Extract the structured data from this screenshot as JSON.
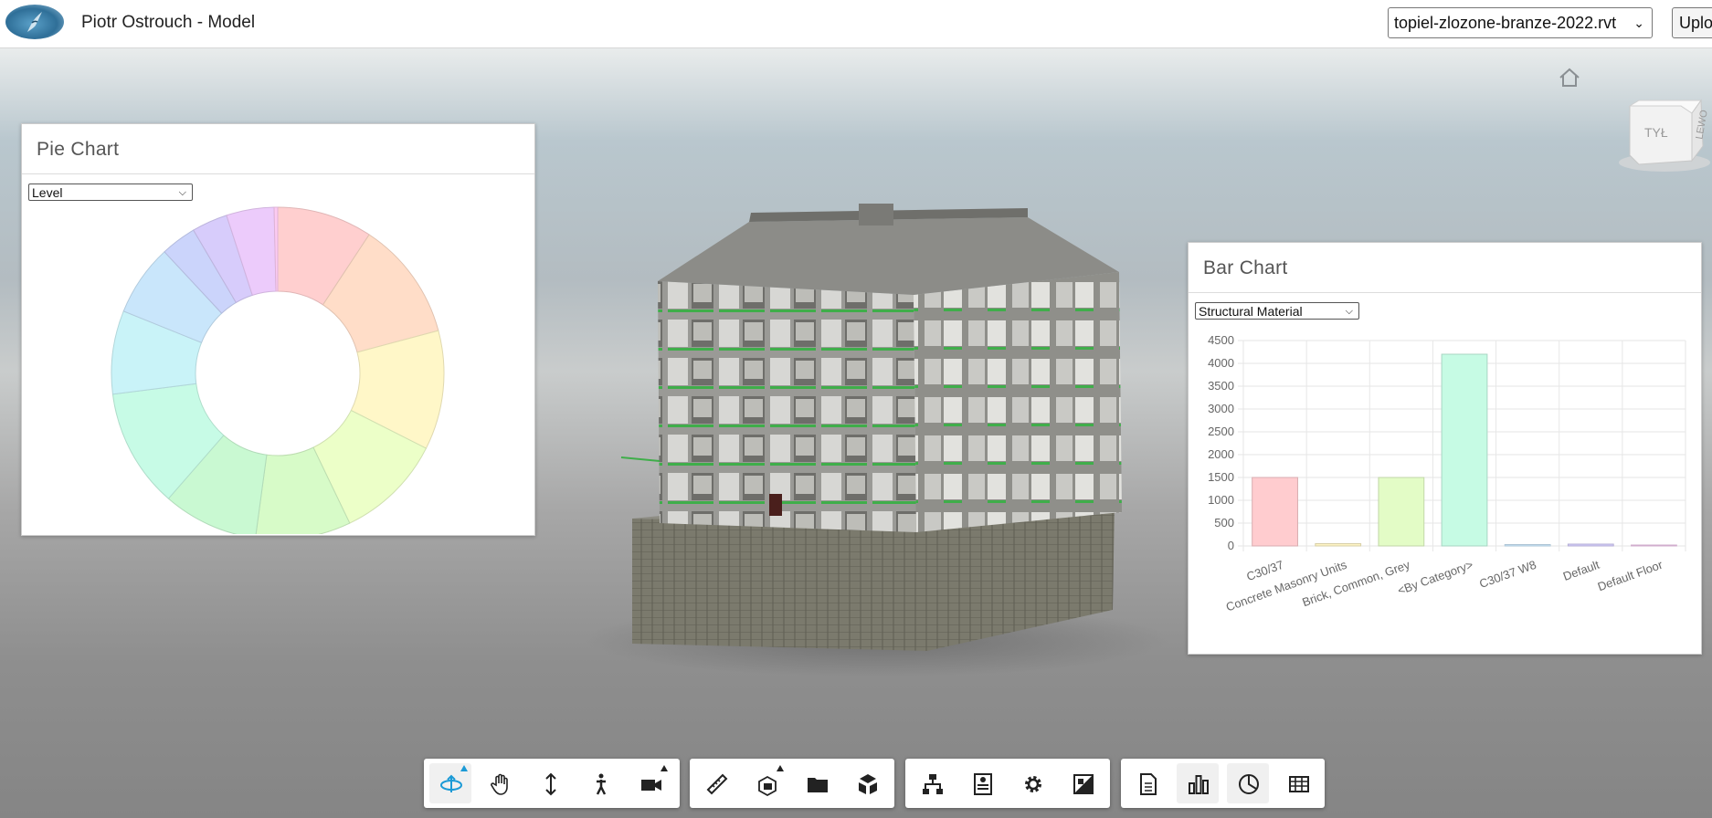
{
  "header": {
    "title": "Piotr Ostrouch - Model",
    "model_file": "topiel-zlozone-branze-2022.rvt",
    "upload_label": "Upload"
  },
  "viewer": {
    "viewcube_faces": [
      "TYŁ",
      "LEWO"
    ],
    "icons": [
      "home-icon",
      "viewcube"
    ]
  },
  "pie_panel": {
    "title": "Pie Chart",
    "group_by": "Level"
  },
  "bar_panel": {
    "title": "Bar Chart",
    "group_by": "Structural Material"
  },
  "toolbar": {
    "groups": [
      [
        "orbit-icon",
        "pan-icon",
        "zoom-icon",
        "first-person-icon",
        "camera-icon"
      ],
      [
        "measure-icon",
        "section-icon",
        "model-browser-icon",
        "explode-icon"
      ],
      [
        "model-structure-icon",
        "properties-icon",
        "settings-icon",
        "fullscreen-icon"
      ],
      [
        "document-icon",
        "bar-chart-icon",
        "pie-chart-icon",
        "table-icon"
      ]
    ]
  },
  "chart_data": [
    {
      "type": "pie",
      "variant": "donut",
      "labels": [],
      "values": [
        8,
        10,
        10,
        9,
        8,
        8,
        10,
        7,
        6,
        3,
        3,
        4,
        0.3
      ],
      "colors": [
        "#ffcfcf",
        "#ffddc8",
        "#fff7c8",
        "#ecffc8",
        "#d7fbc8",
        "#c9f9d2",
        "#c7fbe6",
        "#c9f3f8",
        "#c9e6fb",
        "#cbd4fb",
        "#d7ccfb",
        "#eccbfb",
        "#fccbf2"
      ]
    },
    {
      "type": "bar",
      "categories": [
        "C30/37",
        "Concrete Masonry Units",
        "Brick, Common, Grey",
        "<By Category>",
        "C30/37 W8",
        "Default",
        "Default Floor"
      ],
      "values": [
        1500,
        50,
        1500,
        4200,
        30,
        40,
        20
      ],
      "colors": [
        "#ffcccf",
        "#fdf3c4",
        "#e3fcc6",
        "#c6fbe4",
        "#cbe8fb",
        "#d4cdfa",
        "#f6cdf2"
      ],
      "ylim": [
        0,
        4500
      ],
      "yticks": [
        0,
        500,
        1000,
        1500,
        2000,
        2500,
        3000,
        3500,
        4000,
        4500
      ],
      "grid": true
    }
  ]
}
